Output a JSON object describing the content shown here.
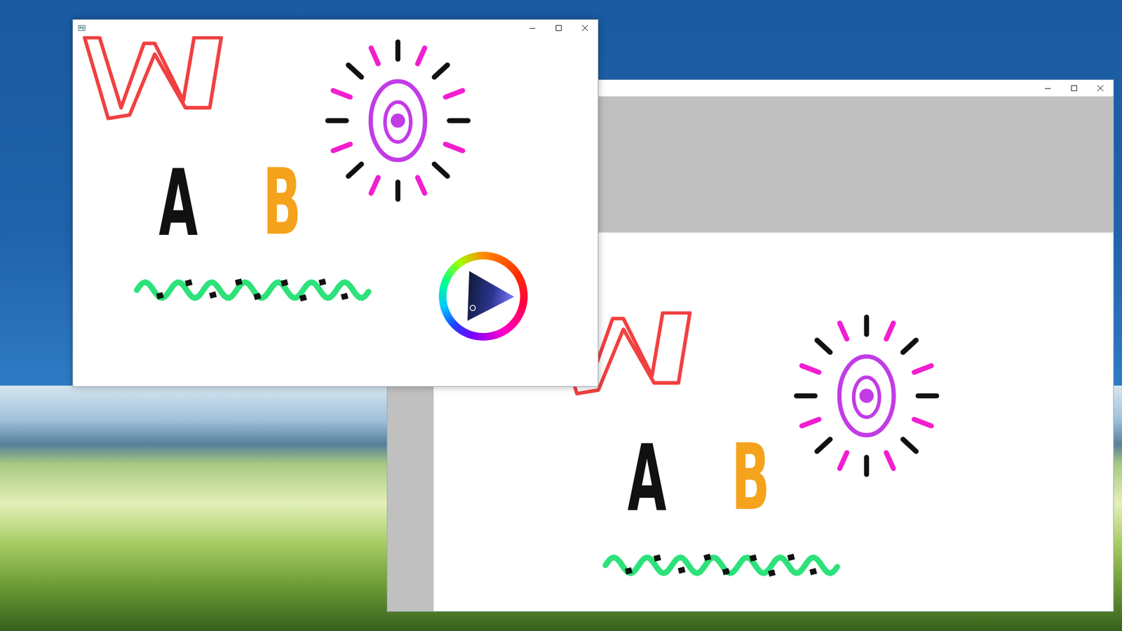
{
  "windows": [
    {
      "kind": "editor",
      "has_app_icon": true,
      "color_wheel": true,
      "gray_margin": false,
      "letters": [
        {
          "text": "A",
          "color": "#111111"
        },
        {
          "text": "B",
          "color": "#f5a31c"
        }
      ]
    },
    {
      "kind": "preview",
      "has_app_icon": false,
      "color_wheel": false,
      "gray_margin": true,
      "letters": [
        {
          "text": "A",
          "color": "#111111"
        },
        {
          "text": "B",
          "color": "#f5a31c"
        }
      ]
    }
  ]
}
